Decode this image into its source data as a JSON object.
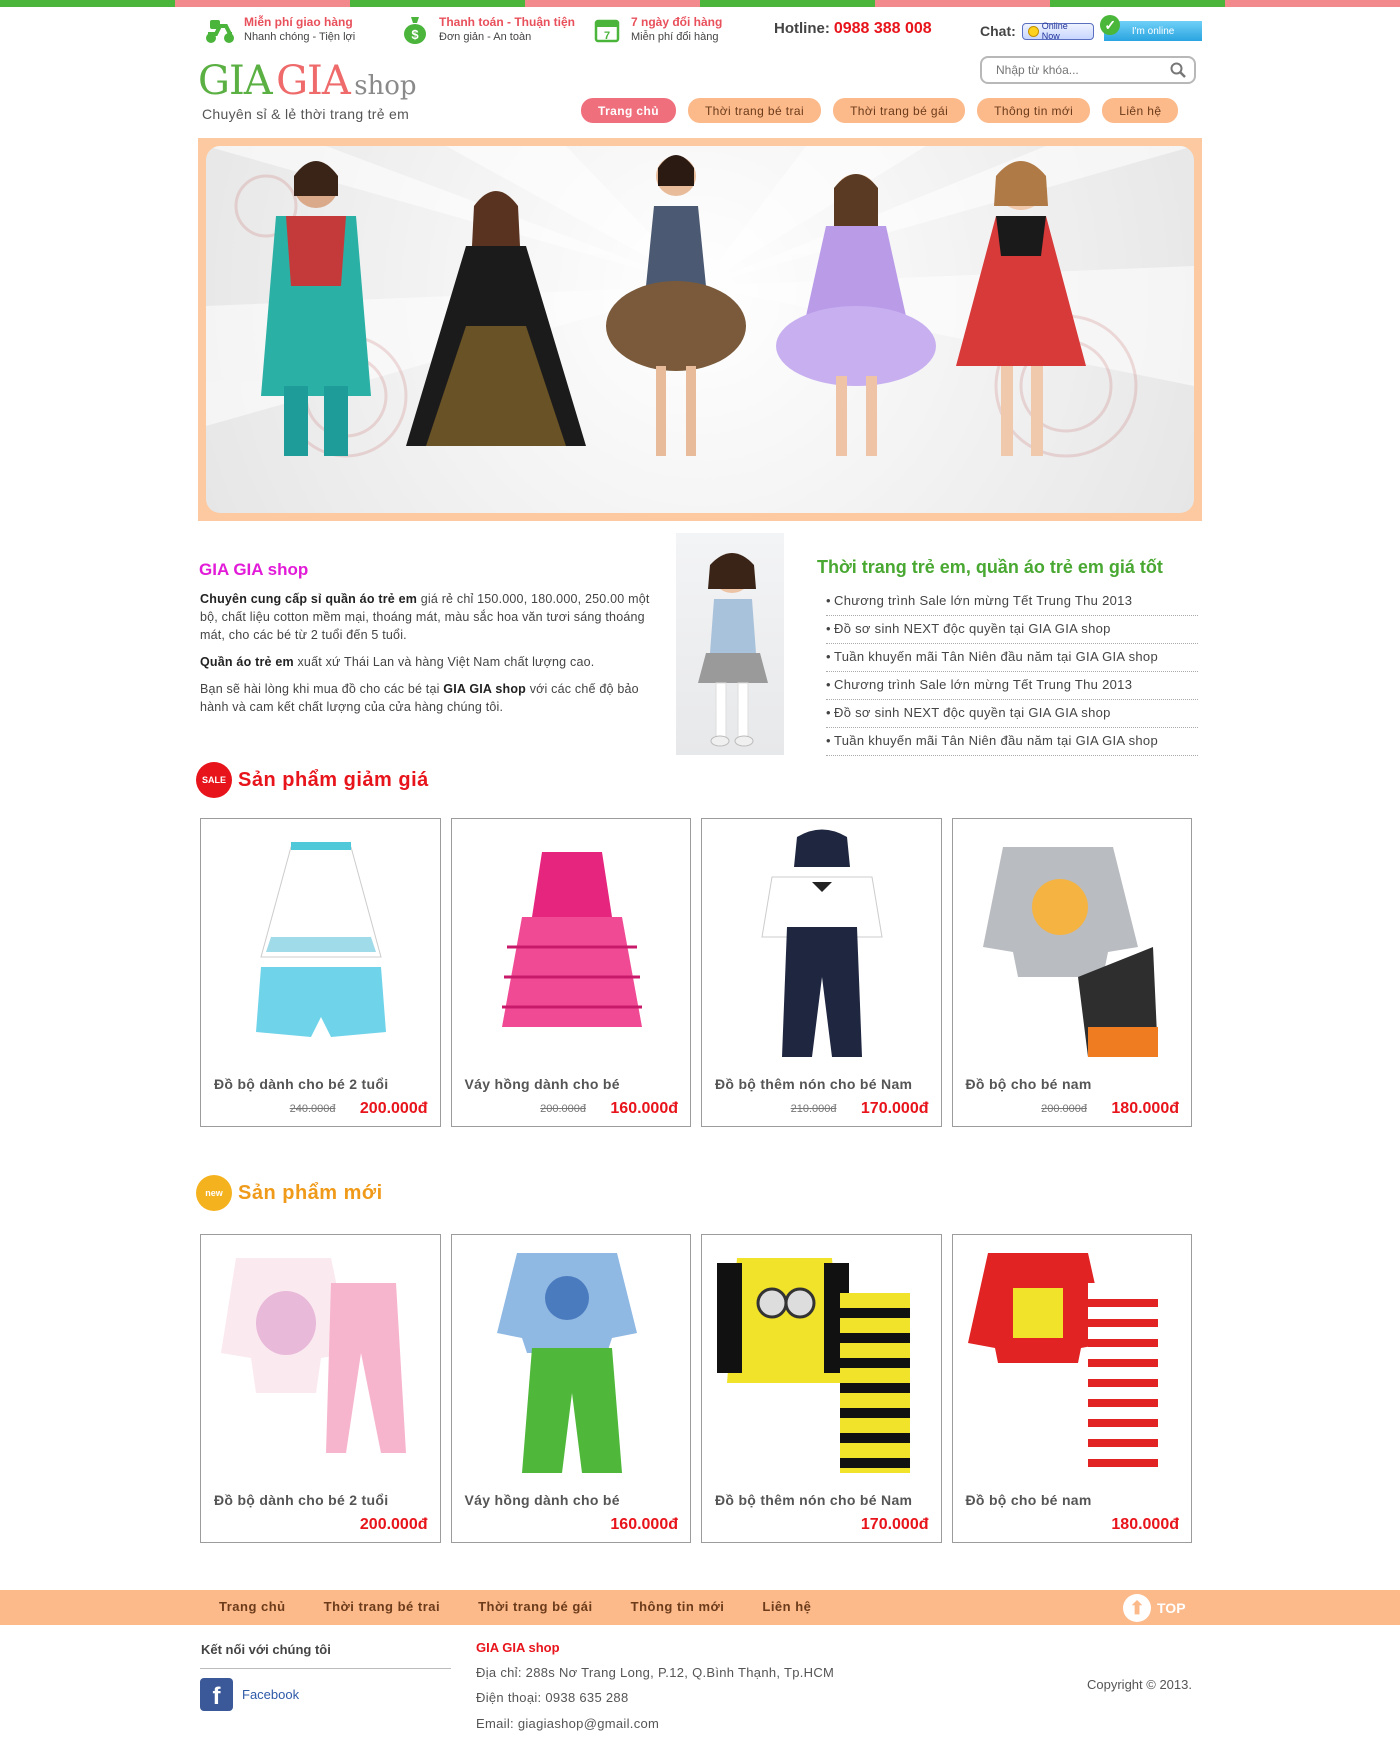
{
  "colors": {
    "stripe": [
      "#4ab43b",
      "#f28a8d",
      "#4ab43b",
      "#f28a8d",
      "#4ab43b",
      "#f28a8d",
      "#4ab43b",
      "#f28a8d"
    ],
    "accent_orange": "#fcb98a",
    "accent_pink": "#ef6f7d",
    "price_red": "#e8141b",
    "news_green": "#49a832",
    "intro_magenta": "#e21bd8",
    "sale_red": "#e8141b",
    "new_orange": "#f09a1a"
  },
  "services": [
    {
      "icon": "scooter-icon",
      "title": "Miễn phí giao hàng",
      "sub": "Nhanh chóng - Tiện lợi"
    },
    {
      "icon": "money-bag-icon",
      "title": "Thanh toán - Thuận tiện",
      "sub": "Đơn giản - An toàn"
    },
    {
      "icon": "calendar-icon",
      "title": "7 ngày đổi hàng",
      "sub": "Miễn phí đổi hàng"
    }
  ],
  "hotline": {
    "label": "Hotline:",
    "number": "0988 388 008"
  },
  "chat": {
    "label": "Chat:",
    "badge1": "Online Now",
    "badge2": "I'm online"
  },
  "logo": {
    "part1": "GIA",
    "part2": "GIA",
    "part3": "shop",
    "tagline": "Chuyên sỉ & lẻ thời trang trẻ em"
  },
  "search": {
    "placeholder": "Nhập từ khóa..."
  },
  "nav": [
    "Trang chủ",
    "Thời trang bé trai",
    "Thời trang bé gái",
    "Thông tin mới",
    "Liên hệ"
  ],
  "intro": {
    "title": "GIA GIA shop",
    "p1_bold": "Chuyên cung cấp sỉ quần áo trẻ em",
    "p1_rest": " giá rẻ chỉ 150.000, 180.000, 250.00 một bộ, chất liệu cotton mềm mại, thoáng mát, màu sắc hoa văn tươi sáng thoáng mát, cho các bé từ 2 tuổi đến 5 tuổi.",
    "p2_bold": "Quần áo trẻ em",
    "p2_rest": " xuất xứ Thái Lan và hàng Việt Nam chất lượng cao.",
    "p3_a": "Bạn sẽ hài lòng khi mua đồ cho các bé tại ",
    "p3_bold": "GIA GIA shop",
    "p3_b": " với các chế độ bảo hành và cam kết chất lượng của cửa hàng chúng tôi."
  },
  "news": {
    "title": "Thời trang trẻ em, quần áo trẻ em giá tốt",
    "items": [
      "Chương trình Sale lớn mừng Tết Trung Thu 2013",
      "Đồ sơ sinh NEXT độc quyền tại GIA GIA shop",
      "Tuần khuyến mãi Tân Niên đầu năm tại GIA GIA shop",
      "Chương trình Sale lớn mừng Tết Trung Thu 2013",
      "Đồ sơ sinh NEXT độc quyền tại GIA GIA shop",
      "Tuần khuyến mãi Tân Niên đầu năm tại GIA GIA shop"
    ]
  },
  "sale_section": {
    "badge": "SALE",
    "title": "Sản phẩm giảm giá",
    "products": [
      {
        "name": "Đồ bộ dành cho bé 2 tuổi",
        "old": "240.000đ",
        "price": "200.000đ"
      },
      {
        "name": "Váy hồng dành cho bé",
        "old": "200.000đ",
        "price": "160.000đ"
      },
      {
        "name": "Đồ bộ thêm nón cho bé Nam",
        "old": "210.000đ",
        "price": "170.000đ"
      },
      {
        "name": "Đồ bộ cho bé nam",
        "old": "200.000đ",
        "price": "180.000đ"
      }
    ]
  },
  "new_section": {
    "badge": "new",
    "title": "Sản phẩm mới",
    "products": [
      {
        "name": "Đồ bộ dành cho bé 2 tuổi",
        "price": "200.000đ"
      },
      {
        "name": "Váy hồng dành cho bé",
        "price": "160.000đ"
      },
      {
        "name": "Đồ bộ thêm nón cho bé Nam",
        "price": "170.000đ"
      },
      {
        "name": "Đồ bộ cho bé nam",
        "price": "180.000đ"
      }
    ]
  },
  "footer": {
    "nav": [
      "Trang chủ",
      "Thời trang bé trai",
      "Thời trang bé gái",
      "Thông tin mới",
      "Liên hệ"
    ],
    "top_label": "TOP",
    "connect_title": "Kết nối với chúng tôi",
    "facebook_label": "Facebook",
    "shop_name": "GIA GIA shop",
    "address": "Địa chỉ: 288s Nơ Trang Long, P.12, Q.Bình Thạnh, Tp.HCM",
    "phone": "Điện thoại: 0938 635 288",
    "email": "Email: giagiashop@gmail.com",
    "copyright": "Copyright © 2013."
  }
}
